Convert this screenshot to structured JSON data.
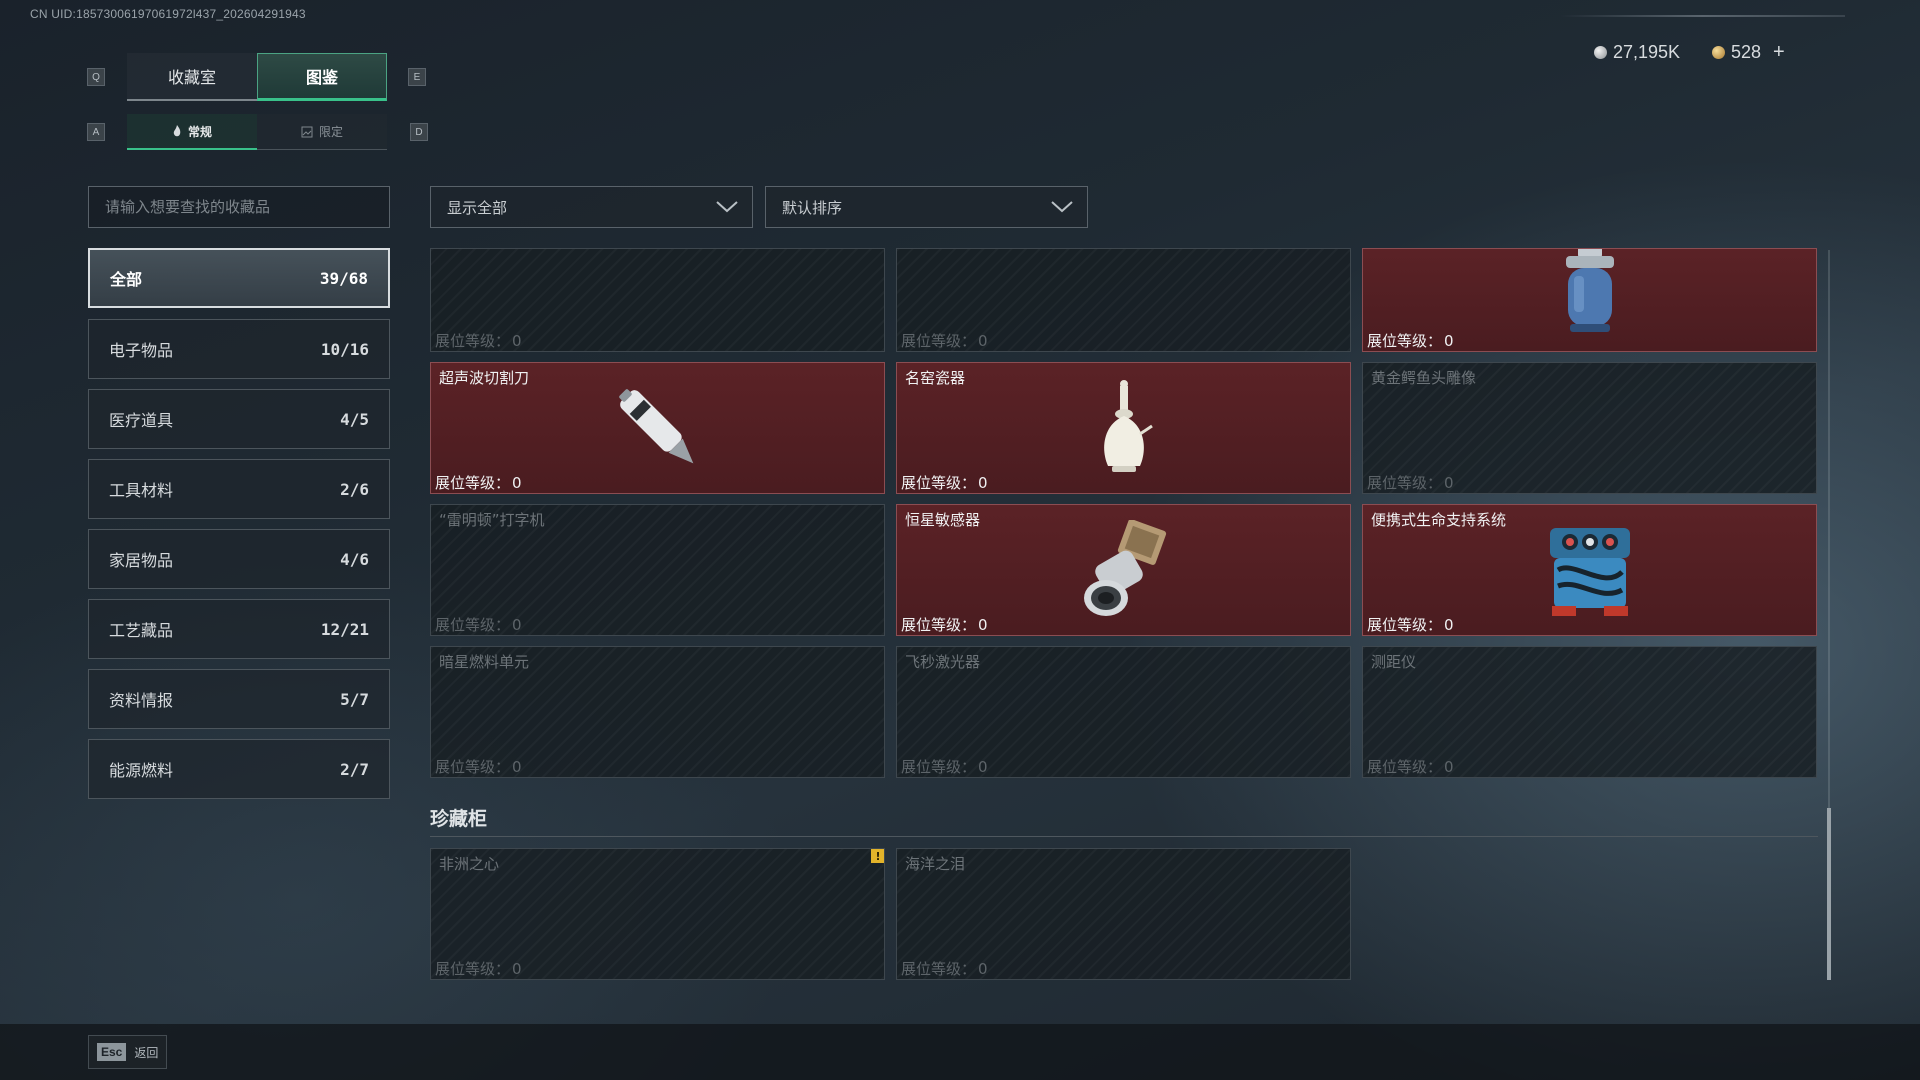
{
  "uid_text": "CN UID:18573006197061972l437_202604291943",
  "currency": {
    "silver": "27,195K",
    "gold": "528",
    "add_label": "+"
  },
  "main_tabs": {
    "left_key": "Q",
    "right_key": "E",
    "items": [
      {
        "label": "收藏室"
      },
      {
        "label": "图鉴"
      }
    ]
  },
  "sub_tabs": {
    "left_key": "A",
    "right_key": "D",
    "items": [
      {
        "label": "常规"
      },
      {
        "label": "限定"
      }
    ]
  },
  "search": {
    "placeholder": "请输入想要查找的收藏品"
  },
  "categories": [
    {
      "label": "全部",
      "count": "39/68"
    },
    {
      "label": "电子物品",
      "count": "10/16"
    },
    {
      "label": "医疗道具",
      "count": "4/5"
    },
    {
      "label": "工具材料",
      "count": "2/6"
    },
    {
      "label": "家居物品",
      "count": "4/6"
    },
    {
      "label": "工艺藏品",
      "count": "12/21"
    },
    {
      "label": "资料情报",
      "count": "5/7"
    },
    {
      "label": "能源燃料",
      "count": "2/7"
    }
  ],
  "filters": {
    "show": "显示全部",
    "sort": "默认排序"
  },
  "level_label": "展位等级：",
  "items": [
    {
      "name": "",
      "level": "0",
      "owned": false
    },
    {
      "name": "",
      "level": "0",
      "owned": false
    },
    {
      "name": "",
      "level": "0",
      "owned": true
    },
    {
      "name": "超声波切割刀",
      "level": "0",
      "owned": true
    },
    {
      "name": "名窑瓷器",
      "level": "0",
      "owned": true
    },
    {
      "name": "黄金鳄鱼头雕像",
      "level": "0",
      "owned": false
    },
    {
      "name": "“雷明顿”打字机",
      "level": "0",
      "owned": false
    },
    {
      "name": "恒星敏感器",
      "level": "0",
      "owned": true
    },
    {
      "name": "便携式生命支持系统",
      "level": "0",
      "owned": true
    },
    {
      "name": "暗星燃料单元",
      "level": "0",
      "owned": false
    },
    {
      "name": "飞秒激光器",
      "level": "0",
      "owned": false
    },
    {
      "name": "测距仪",
      "level": "0",
      "owned": false
    }
  ],
  "treasure": {
    "title": "珍藏柜",
    "items": [
      {
        "name": "非洲之心",
        "level": "0",
        "owned": false,
        "warning": "!"
      },
      {
        "name": "海洋之泪",
        "level": "0",
        "owned": false
      }
    ]
  },
  "footer": {
    "esc_key": "Esc",
    "back_label": "返回"
  }
}
